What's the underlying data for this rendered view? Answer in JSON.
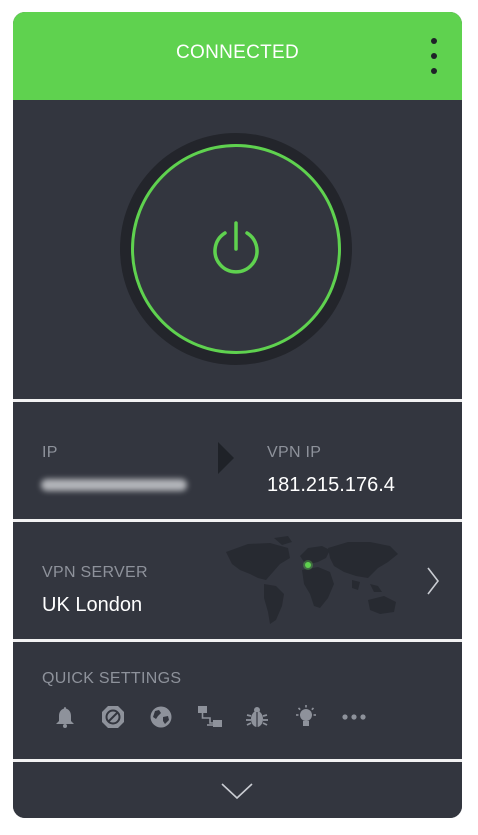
{
  "header": {
    "status": "CONNECTED",
    "menu_icon": "kebab-menu-icon"
  },
  "power": {
    "icon": "power-icon",
    "state_color": "#5fd24f"
  },
  "ip": {
    "ip_label": "IP",
    "ip_value_hidden": true,
    "vpn_ip_label": "VPN IP",
    "vpn_ip_value": "181.215.176.4"
  },
  "server": {
    "label": "VPN SERVER",
    "value": "UK London",
    "chevron_icon": "chevron-right-icon"
  },
  "quick_settings": {
    "label": "QUICK SETTINGS",
    "icons": [
      "bell-icon",
      "block-icon",
      "globe-icon",
      "network-icon",
      "bug-icon",
      "bulb-icon",
      "more-icon"
    ]
  },
  "footer": {
    "icon": "chevron-down-icon"
  },
  "colors": {
    "accent": "#5fd24f",
    "panel": "#33363f",
    "ring": "#23252b",
    "muted": "#8e929b"
  }
}
